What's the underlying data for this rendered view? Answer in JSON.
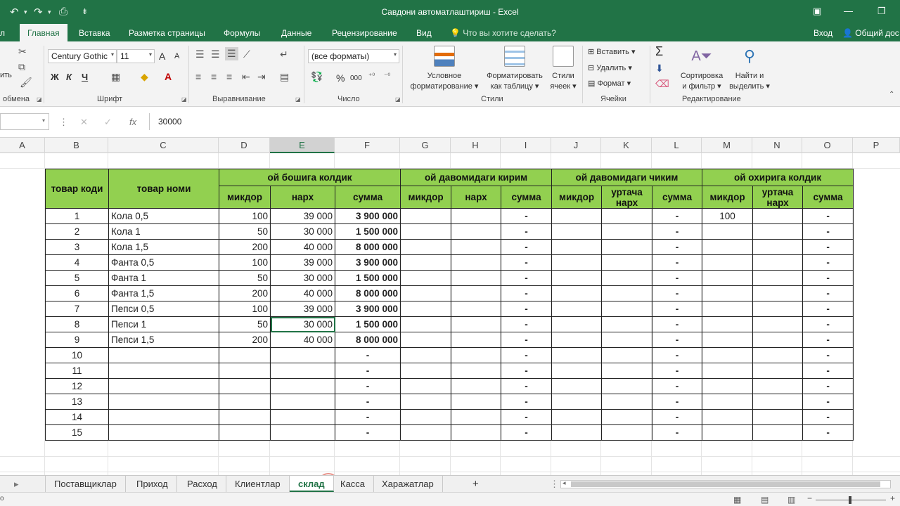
{
  "titlebar": {
    "title": "Савдони автоматлаштириш - Excel",
    "undo": "↶",
    "redo": "↷",
    "preview": "⎙",
    "customize": "⇟"
  },
  "tabs": {
    "file": "л",
    "items": [
      "Главная",
      "Вставка",
      "Разметка страницы",
      "Формулы",
      "Данные",
      "Рецензирование",
      "Вид"
    ],
    "tell_me": "Что вы хотите сделать?",
    "signin": "Вход",
    "share": "Общий дос"
  },
  "ribbon": {
    "clipboard": {
      "label": "обмена",
      "paste_partial": "ить"
    },
    "font": {
      "name": "Century Gothic",
      "size": "11",
      "grow": "A",
      "shrink": "A",
      "bold": "Ж",
      "italic": "К",
      "underline": "Ч",
      "label": "Шрифт"
    },
    "alignment": {
      "label": "Выравнивание"
    },
    "number": {
      "format": "(все форматы)",
      "percent": "%",
      "thousands": "000",
      "label": "Число"
    },
    "styles": {
      "conditional": "Условное",
      "conditional2": "форматирование",
      "as_table": "Форматировать",
      "as_table2": "как таблицу",
      "cell_styles": "Стили",
      "cell_styles2": "ячеек",
      "label": "Стили"
    },
    "cells": {
      "insert": "Вставить",
      "delete": "Удалить",
      "format": "Формат",
      "label": "Ячейки"
    },
    "editing": {
      "sort": "Сортировка",
      "sort2": "и фильтр",
      "find": "Найти и",
      "find2": "выделить",
      "label": "Редактирование"
    }
  },
  "formula_bar": {
    "value": "30000",
    "fx": "fx"
  },
  "columns": [
    "A",
    "B",
    "C",
    "D",
    "E",
    "F",
    "G",
    "H",
    "I",
    "J",
    "K",
    "L",
    "M",
    "N",
    "O",
    "P"
  ],
  "selected_column": "E",
  "table": {
    "header_top": {
      "code": "товар коди",
      "name": "товар номи",
      "opening": "ой бошига колдик",
      "incoming": "ой давомидаги кирим",
      "outgoing": "ой давомидаги чиким",
      "closing": "ой охирига колдик"
    },
    "header_sub": [
      "микдор",
      "нарх",
      "сумма",
      "микдор",
      "нарх",
      "сумма",
      "микдор",
      "уртача нарх",
      "сумма",
      "микдор",
      "уртача нарх",
      "сумма"
    ],
    "rows": [
      {
        "code": "1",
        "name": "Кола 0,5",
        "qty": "100",
        "price": "39 000",
        "sum": "3 900 000",
        "in_sum": "-",
        "out_sum": "-",
        "end_qty": "100",
        "end_sum": "-"
      },
      {
        "code": "2",
        "name": "Кола 1",
        "qty": "50",
        "price": "30 000",
        "sum": "1 500 000",
        "in_sum": "-",
        "out_sum": "-",
        "end_qty": "",
        "end_sum": "-"
      },
      {
        "code": "3",
        "name": "Кола 1,5",
        "qty": "200",
        "price": "40 000",
        "sum": "8 000 000",
        "in_sum": "-",
        "out_sum": "-",
        "end_qty": "",
        "end_sum": "-"
      },
      {
        "code": "4",
        "name": "Фанта 0,5",
        "qty": "100",
        "price": "39 000",
        "sum": "3 900 000",
        "in_sum": "-",
        "out_sum": "-",
        "end_qty": "",
        "end_sum": "-"
      },
      {
        "code": "5",
        "name": "Фанта 1",
        "qty": "50",
        "price": "30 000",
        "sum": "1 500 000",
        "in_sum": "-",
        "out_sum": "-",
        "end_qty": "",
        "end_sum": "-"
      },
      {
        "code": "6",
        "name": "Фанта 1,5",
        "qty": "200",
        "price": "40 000",
        "sum": "8 000 000",
        "in_sum": "-",
        "out_sum": "-",
        "end_qty": "",
        "end_sum": "-"
      },
      {
        "code": "7",
        "name": "Пепси 0,5",
        "qty": "100",
        "price": "39 000",
        "sum": "3 900 000",
        "in_sum": "-",
        "out_sum": "-",
        "end_qty": "",
        "end_sum": "-"
      },
      {
        "code": "8",
        "name": "Пепси 1",
        "qty": "50",
        "price": "30 000",
        "sum": "1 500 000",
        "in_sum": "-",
        "out_sum": "-",
        "end_qty": "",
        "end_sum": "-"
      },
      {
        "code": "9",
        "name": "Пепси 1,5",
        "qty": "200",
        "price": "40 000",
        "sum": "8 000 000",
        "in_sum": "-",
        "out_sum": "-",
        "end_qty": "",
        "end_sum": "-"
      },
      {
        "code": "10",
        "name": "",
        "qty": "",
        "price": "",
        "sum": "-",
        "in_sum": "-",
        "out_sum": "-",
        "end_qty": "",
        "end_sum": "-"
      },
      {
        "code": "11",
        "name": "",
        "qty": "",
        "price": "",
        "sum": "-",
        "in_sum": "-",
        "out_sum": "-",
        "end_qty": "",
        "end_sum": "-"
      },
      {
        "code": "12",
        "name": "",
        "qty": "",
        "price": "",
        "sum": "-",
        "in_sum": "-",
        "out_sum": "-",
        "end_qty": "",
        "end_sum": "-"
      },
      {
        "code": "13",
        "name": "",
        "qty": "",
        "price": "",
        "sum": "-",
        "in_sum": "-",
        "out_sum": "-",
        "end_qty": "",
        "end_sum": "-"
      },
      {
        "code": "14",
        "name": "",
        "qty": "",
        "price": "",
        "sum": "-",
        "in_sum": "-",
        "out_sum": "-",
        "end_qty": "",
        "end_sum": "-"
      },
      {
        "code": "15",
        "name": "",
        "qty": "",
        "price": "",
        "sum": "-",
        "in_sum": "-",
        "out_sum": "-",
        "end_qty": "",
        "end_sum": "-"
      }
    ]
  },
  "sheet_tabs": {
    "items": [
      "Поставщиклар",
      "Приход",
      "Расход",
      "Клиентлар",
      "склад",
      "Касса",
      "Харажатлар"
    ],
    "active": "склад",
    "add": "+"
  },
  "colors": {
    "brand": "#217346",
    "header_fill": "#92d050"
  }
}
